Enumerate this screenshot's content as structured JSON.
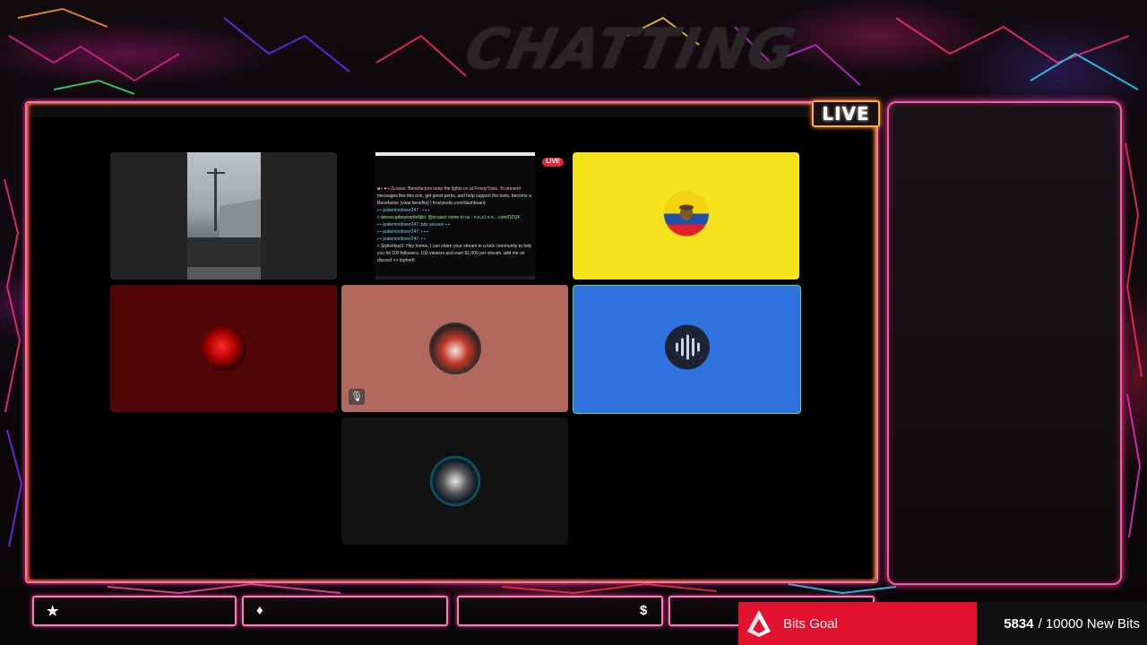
{
  "overlay": {
    "scene_title": "CHATTING",
    "live_badge": "LIVE"
  },
  "call_grid": {
    "tiles": [
      {
        "name": "participant-1",
        "type": "camera"
      },
      {
        "name": "participant-2",
        "type": "screen-share",
        "badge": "LIVE"
      },
      {
        "name": "participant-3",
        "type": "flag-avatar",
        "background": "#f4e21a"
      },
      {
        "name": "participant-4",
        "type": "avatar",
        "background": "#520607"
      },
      {
        "name": "participant-5",
        "type": "avatar",
        "background": "#b2685d",
        "muted": true
      },
      {
        "name": "participant-6",
        "type": "audio-avatar",
        "background": "#2f72e0"
      },
      {
        "name": "participant-7",
        "type": "avatar",
        "background": "#131313"
      }
    ],
    "screen_share_lines": [
      "■ ▪ ♥ ▪ Zcuaso: Benefactors keep the lights on at FrostyTools. To prevent",
      "messages like this one, get great perks, and help support the tools, become a",
      "Benefactor  (view benefits)  | frostytools.com/dashboard",
      "▪ ▪ pokemonlover247 :  ▪ ▪ ▪",
      "◊ anewcupbookwrite8jiki: @zcuaso come to us - n.o.z.l.n.o.. .com/DZQF",
      "▪ ▪ pokemonlover247: bits yeeeee ▪ ▪",
      "▪ ▪ pokemonlover247: ▪ ▪ ▪",
      "▪ ▪ pokemonlover247: ▪ ▪",
      "◊ Stylishbuy2: Hey homie, I can share your stream in a kick community to help",
      "you hit 200 followers, 100 viewers and earn $1,000 per stream. add me on",
      "discord >> topher8"
    ]
  },
  "bottom_bars": [
    {
      "icon": "star-icon",
      "glyph": "★"
    },
    {
      "icon": "diamond-icon",
      "glyph": "♦"
    },
    {
      "icon": "dollar-icon",
      "glyph": "$"
    },
    {
      "icon": "",
      "glyph": ""
    }
  ],
  "bits_goal": {
    "label": "Bits Goal",
    "current": "5834",
    "target": "/ 10000 New Bits",
    "progress_fraction": 0.5834
  },
  "colors": {
    "accent_pink": "#ff57a8",
    "accent_orange": "#ffb03a",
    "bits_red": "#e3122f",
    "tile_yellow": "#f4e21a",
    "tile_blue": "#2f72e0"
  }
}
